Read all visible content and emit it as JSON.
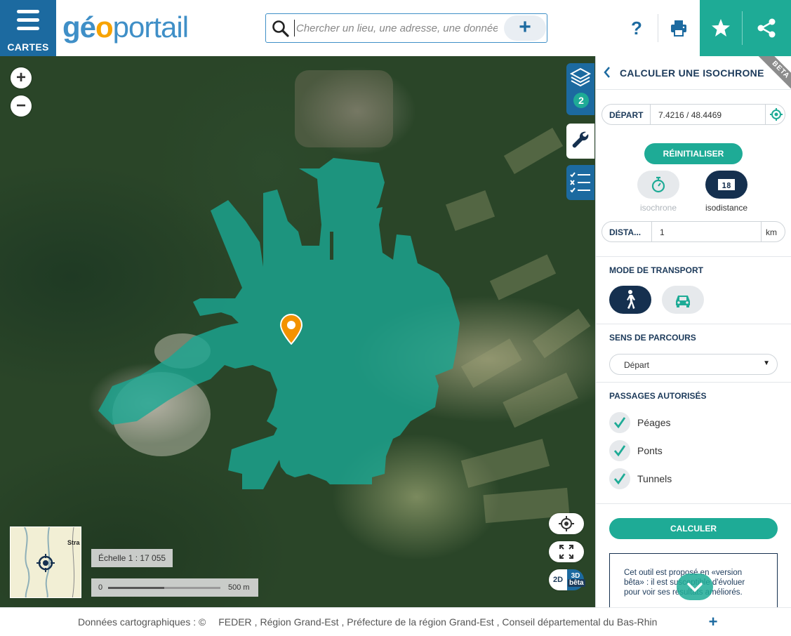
{
  "header": {
    "menu_label": "CARTES",
    "logo": {
      "part1": "gé",
      "part2": "o",
      "part3": "portail"
    },
    "search_placeholder": "Chercher un lieu, une adresse, une donnée",
    "help_label": "?",
    "colors": {
      "brand_blue": "#1c6aa0",
      "accent_green": "#1eab96",
      "logo_orange": "#f7a300"
    }
  },
  "map": {
    "zoom_in": "+",
    "zoom_out": "−",
    "minimap_label": "Stra",
    "scale_text": "Échelle 1 : 17 055",
    "scale_zero": "0",
    "scale_distance": "500 m",
    "view_2d": "2D",
    "view_3d": "3D",
    "view_beta": "bêta",
    "layers_count": "2"
  },
  "panel": {
    "title": "CALCULER UNE ISOCHRONE",
    "beta_ribbon": "BETA",
    "depart_label": "DÉPART",
    "depart_value": "7.4216 / 48.4469",
    "reset_label": "RÉINITIALISER",
    "mode_isochrone": "isochrone",
    "mode_isodistance": "isodistance",
    "distance_label": "DISTA...",
    "distance_value": "1",
    "distance_unit": "km",
    "transport_title": "MODE DE TRANSPORT",
    "direction_title": "SENS DE PARCOURS",
    "direction_value": "Départ",
    "passages_title": "PASSAGES AUTORISÉS",
    "passages": [
      {
        "label": "Péages",
        "checked": true
      },
      {
        "label": "Ponts",
        "checked": true
      },
      {
        "label": "Tunnels",
        "checked": true
      }
    ],
    "compute_label": "CALCULER",
    "beta_note": "Cet outil est proposé en «version bêta» : il est susceptible d'évoluer pour voir ses résultats améliorés."
  },
  "footer": {
    "credits_intro": "Données cartographiques : ©",
    "credits": [
      "FEDER",
      "Région Grand-Est",
      "Préfecture de la région Grand-Est",
      "Conseil départemental du Bas-Rhin"
    ],
    "more": "+"
  }
}
